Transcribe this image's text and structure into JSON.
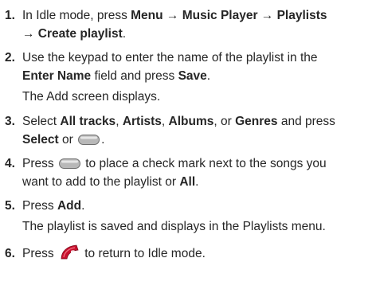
{
  "steps": [
    {
      "num": "1.",
      "l1a": "In Idle mode, press ",
      "l1b": "Menu → Music Player → Playlists",
      "l2": "→ Create playlist",
      "l2end": "."
    },
    {
      "num": "2.",
      "l1": "Use the keypad to enter the name of the playlist in the",
      "l2a": "Enter Name",
      "l2b": " field and press ",
      "l2c": "Save",
      "l2d": ".",
      "note": "The Add screen displays."
    },
    {
      "num": "3.",
      "l1a": "Select ",
      "l1b": "All tracks",
      "l1c": ", ",
      "l1d": "Artists",
      "l1e": ", ",
      "l1f": "Albums",
      "l1g": ", or ",
      "l1h": "Genres",
      "l1i": " and press",
      "l2a": "Select",
      "l2b": " or ",
      "l2c": "."
    },
    {
      "num": "4.",
      "l1a": "Press ",
      "l1b": " to place a check mark next to the songs you",
      "l2a": "want to add to the playlist or ",
      "l2b": "All",
      "l2c": "."
    },
    {
      "num": "5.",
      "l1a": "Press ",
      "l1b": "Add",
      "l1c": ".",
      "note": "The playlist is saved and displays in the Playlists menu."
    },
    {
      "num": "6.",
      "l1a": "Press ",
      "l1b": " to return to Idle mode."
    }
  ],
  "icons": {
    "soft_key": "soft-key-icon",
    "end_key": "end-key-icon"
  },
  "colors": {
    "text": "#262626",
    "soft_key_fill": "#b8b8b8",
    "end_key_fill": "#c8102e"
  }
}
